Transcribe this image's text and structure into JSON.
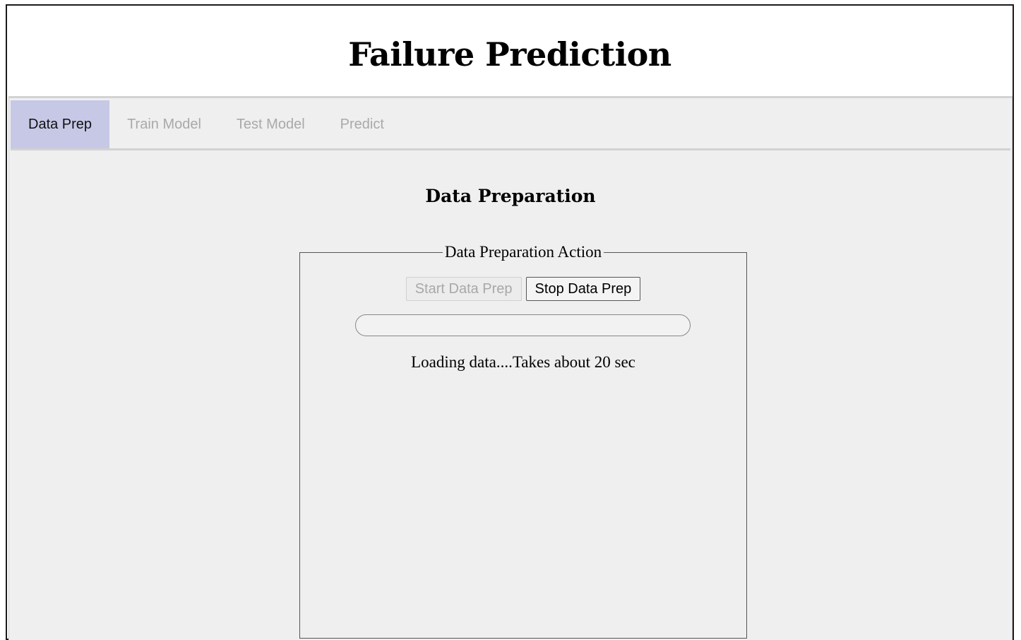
{
  "page": {
    "title": "Failure Prediction"
  },
  "tabs": [
    {
      "label": "Data Prep",
      "active": true
    },
    {
      "label": "Train Model",
      "active": false
    },
    {
      "label": "Test Model",
      "active": false
    },
    {
      "label": "Predict",
      "active": false
    }
  ],
  "section": {
    "title": "Data Preparation",
    "fieldset_legend": "Data Preparation Action",
    "start_button": {
      "label": "Start Data Prep",
      "enabled": false
    },
    "stop_button": {
      "label": "Stop Data Prep",
      "enabled": true
    },
    "progress": 0,
    "status": "Loading data....Takes about 20 sec"
  },
  "colors": {
    "active_tab": "#c6c8e6",
    "inactive_tab_text": "#a9a9a9",
    "panel_background": "#efefef"
  }
}
